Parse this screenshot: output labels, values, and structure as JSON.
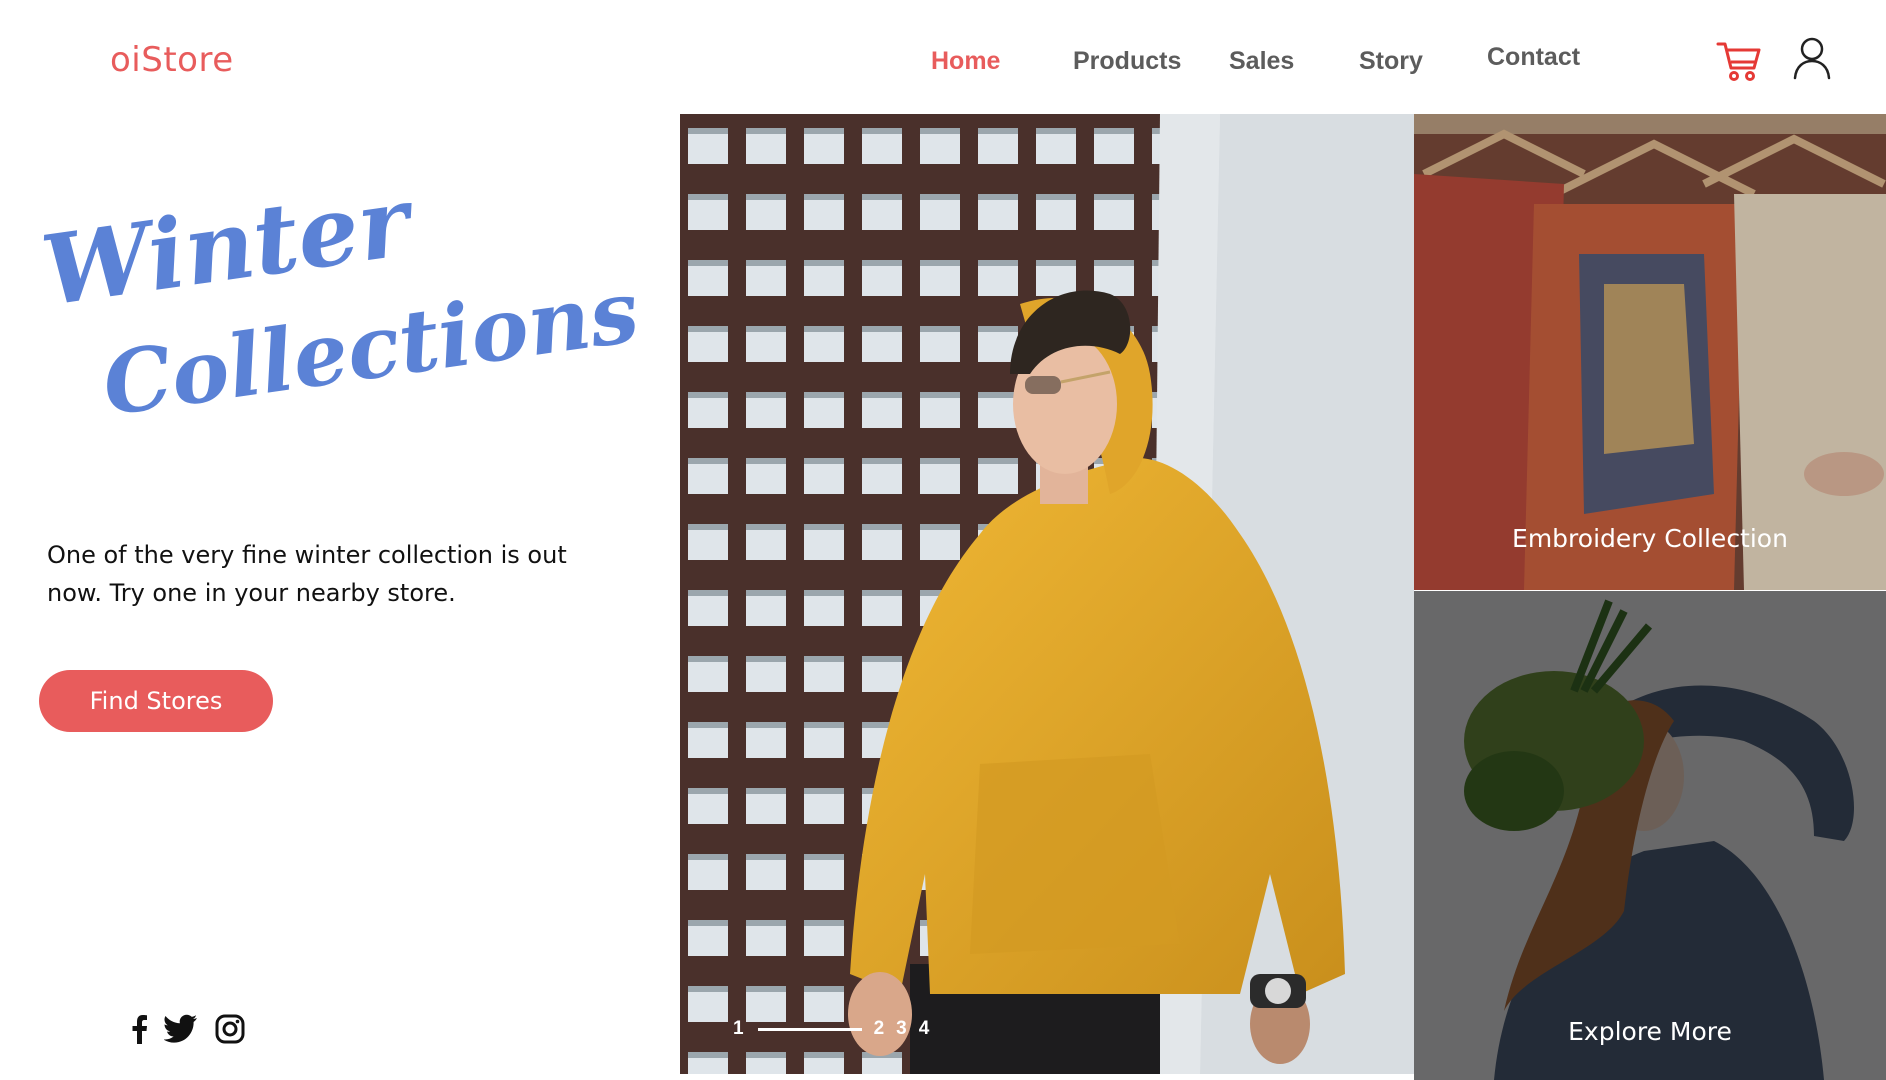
{
  "header": {
    "logo": "oiStore",
    "nav": [
      {
        "label": "Home",
        "active": true
      },
      {
        "label": "Products",
        "active": false
      },
      {
        "label": "Sales",
        "active": false
      },
      {
        "label": "Story",
        "active": false
      },
      {
        "label": "Contact",
        "active": false
      }
    ],
    "icons": {
      "cart": "cart-icon",
      "user": "user-icon"
    }
  },
  "hero": {
    "title_line1": "Winter",
    "title_line2": "Collections",
    "description": "One of the very fine winter collection is out now. Try one in your nearby store.",
    "cta_label": "Find Stores"
  },
  "social": [
    "facebook-icon",
    "twitter-icon",
    "instagram-icon"
  ],
  "slider": {
    "pages": [
      "1",
      "2",
      "3",
      "4"
    ],
    "current": 1
  },
  "tiles": [
    {
      "label": "Embroidery Collection"
    },
    {
      "label": "Explore More"
    }
  ],
  "colors": {
    "accent": "#e85c5c",
    "title_blue": "#5b82d6",
    "nav_gray": "#5c5c5c",
    "hoodie_yellow": "#e3a628"
  }
}
